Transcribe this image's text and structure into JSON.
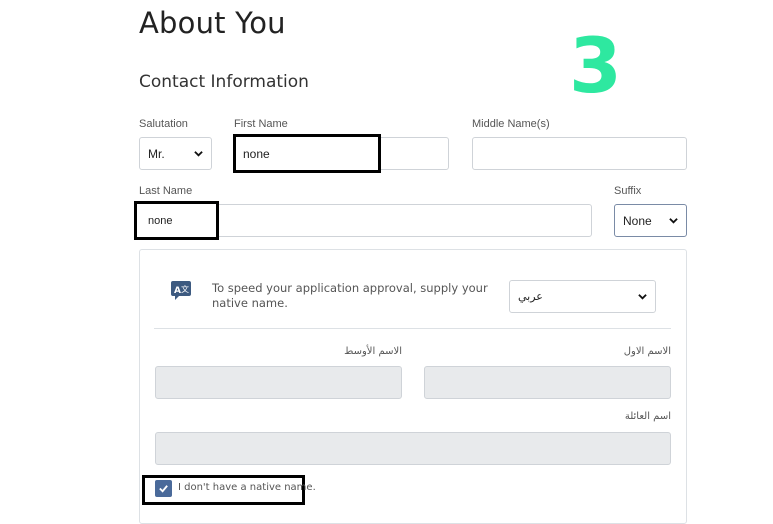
{
  "page": {
    "title": "About You",
    "step": "3",
    "section_title": "Contact Information"
  },
  "form": {
    "salutation": {
      "label": "Salutation",
      "value": "Mr."
    },
    "first_name": {
      "label": "First Name",
      "value": "none"
    },
    "middle_name": {
      "label": "Middle Name(s)",
      "value": ""
    },
    "last_name": {
      "label": "Last Name",
      "value": "none"
    },
    "suffix": {
      "label": "Suffix",
      "value": "None"
    }
  },
  "native_name": {
    "icon": "translate-icon",
    "info_line1": "To speed your application approval, supply your",
    "info_line2": "native name.",
    "language_select": "عربي",
    "middle_label": "الاسم الأوسط",
    "first_label": "الاسم الاول",
    "family_label": "اسم العائلة",
    "no_native_label": "I don't have a native name.",
    "no_native_checked": true
  },
  "colors": {
    "step_accent": "#2ee8a0",
    "checkbox_fill": "#4a6a9a",
    "icon_color": "#3d5a80",
    "highlight_border": "#000000"
  }
}
